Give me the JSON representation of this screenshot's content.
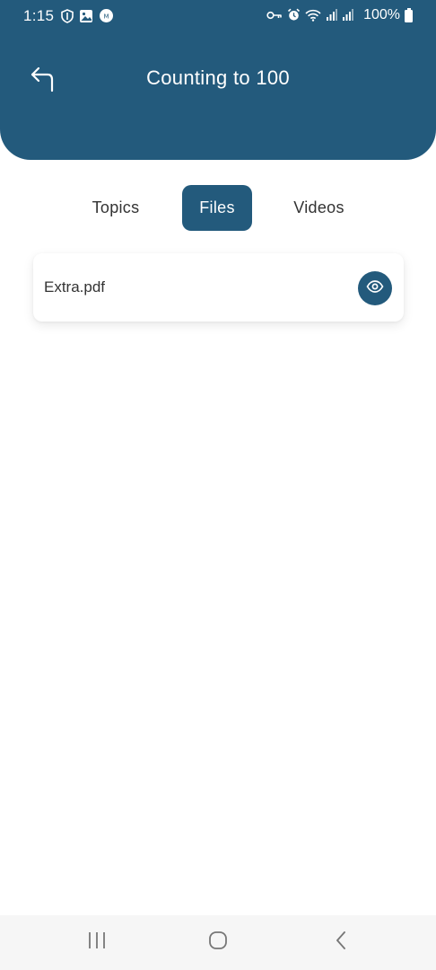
{
  "status_bar": {
    "time": "1:15",
    "battery": "100%",
    "left_icons": [
      "shield-icon",
      "image-icon",
      "chat-icon"
    ],
    "right_icons": [
      "vpn-key-icon",
      "alarm-icon",
      "wifi-icon",
      "signal-icon",
      "signal-icon"
    ]
  },
  "header": {
    "title": "Counting to 100",
    "back_icon": "return-arrow-icon",
    "background": "#235a7c"
  },
  "tabs": [
    {
      "label": "Topics",
      "active": false
    },
    {
      "label": "Files",
      "active": true
    },
    {
      "label": "Videos",
      "active": false
    }
  ],
  "files": [
    {
      "name": "Extra.pdf",
      "action_icon": "eye-icon"
    }
  ],
  "nav_bar": {
    "buttons": [
      "recent-apps-icon",
      "home-icon",
      "back-icon"
    ]
  },
  "colors": {
    "accent": "#235a7c",
    "text": "#333333",
    "background": "#ffffff"
  }
}
